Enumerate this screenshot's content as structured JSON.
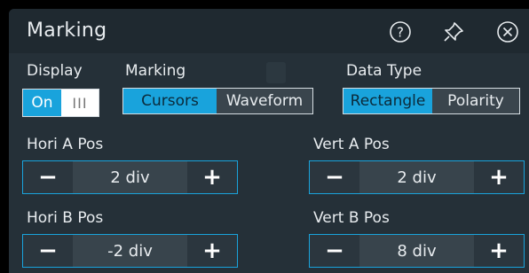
{
  "panel": {
    "title": "Marking"
  },
  "icons": {
    "help": "help-icon",
    "pin": "pin-icon",
    "close": "close-icon"
  },
  "display": {
    "label": "Display",
    "on_label": "On",
    "knob_label": "III"
  },
  "marking": {
    "label": "Marking",
    "options": [
      "Cursors",
      "Waveform"
    ],
    "selected": "Cursors"
  },
  "data_type": {
    "label": "Data Type",
    "options": [
      "Rectangle",
      "Polarity"
    ],
    "selected": "Rectangle"
  },
  "hori_a": {
    "label": "Hori A Pos",
    "value": "2 div"
  },
  "vert_a": {
    "label": "Vert A Pos",
    "value": "2 div"
  },
  "hori_b": {
    "label": "Hori B Pos",
    "value": "-2 div"
  },
  "vert_b": {
    "label": "Vert B Pos",
    "value": "8 div"
  },
  "stepper": {
    "minus": "−",
    "plus": "+"
  },
  "colors": {
    "accent": "#19a3dc",
    "panel_bg": "#253038",
    "title_bg": "#1f2930"
  }
}
